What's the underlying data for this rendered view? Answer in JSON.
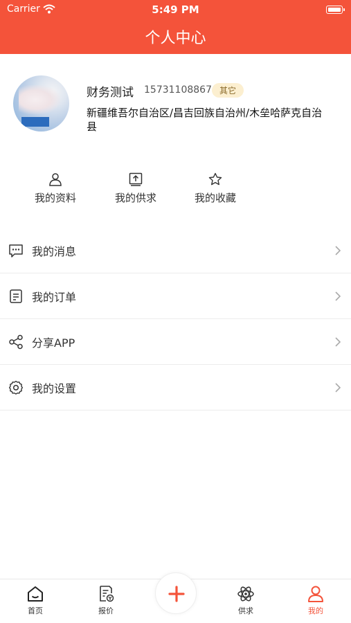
{
  "status_bar": {
    "carrier": "Carrier",
    "time": "5:49 PM"
  },
  "header": {
    "title": "个人中心"
  },
  "profile": {
    "name": "财务测试",
    "phone": "15731108867",
    "badge": "其它",
    "address": "新疆维吾尔自治区/昌吉回族自治州/木垒哈萨克自治县"
  },
  "quick_actions": [
    {
      "label": "我的资料",
      "icon": "user-icon"
    },
    {
      "label": "我的供求",
      "icon": "upload-box-icon"
    },
    {
      "label": "我的收藏",
      "icon": "star-icon"
    }
  ],
  "menu": [
    {
      "label": "我的消息",
      "icon": "message-icon"
    },
    {
      "label": "我的订单",
      "icon": "order-icon"
    },
    {
      "label": "分享APP",
      "icon": "share-icon"
    },
    {
      "label": "我的设置",
      "icon": "settings-icon"
    }
  ],
  "tabbar": [
    {
      "label": "首页",
      "icon": "home-icon"
    },
    {
      "label": "报价",
      "icon": "quote-icon"
    },
    {
      "label": "",
      "icon": "plus-icon"
    },
    {
      "label": "供求",
      "icon": "atom-icon"
    },
    {
      "label": "我的",
      "icon": "user-icon"
    }
  ],
  "colors": {
    "accent": "#f4533a",
    "badge_bg": "#fcefd0",
    "badge_text": "#8a6a2a"
  }
}
